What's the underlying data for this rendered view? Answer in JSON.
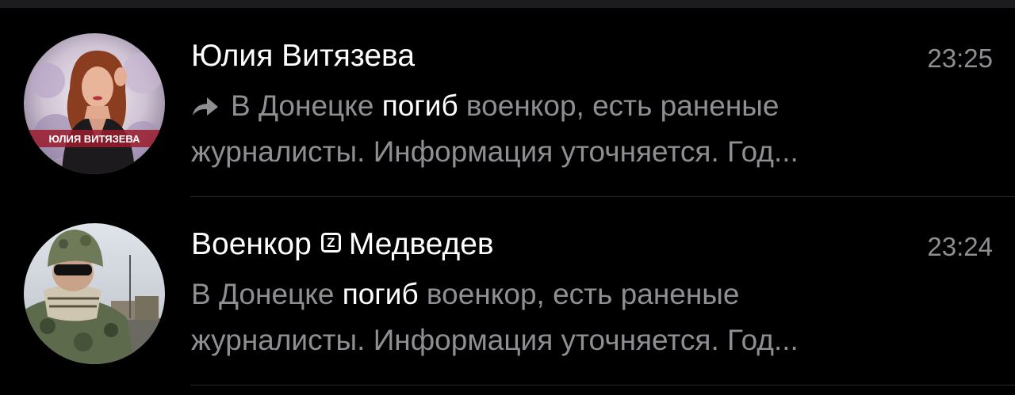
{
  "chats": [
    {
      "name": "Юлия Витязева",
      "avatar_icon": "avatar-photo-woman",
      "avatar_caption": "ЮЛИЯ ВИТЯЗЕВА",
      "time": "23:25",
      "forwarded": true,
      "preview": {
        "line1_before": "В Донецке ",
        "highlight": "погиб",
        "line1_after": " военкор, есть раненые",
        "line2": "журналисты. Информация уточняется. Год..."
      }
    },
    {
      "name_part1": "Военкор",
      "badge_letter": "Z",
      "name_part2": "Медведев",
      "avatar_icon": "avatar-photo-soldier",
      "time": "23:24",
      "forwarded": false,
      "preview": {
        "line1_before": "В Донецке ",
        "highlight": "погиб",
        "line1_after": " военкор, есть раненые",
        "line2": "журналисты. Информация уточняется. Год..."
      }
    }
  ],
  "colors": {
    "background": "#000000",
    "name": "#ffffff",
    "secondary": "#8e8e93",
    "highlight": "#ffffff",
    "separator": "#2a2a2c"
  }
}
